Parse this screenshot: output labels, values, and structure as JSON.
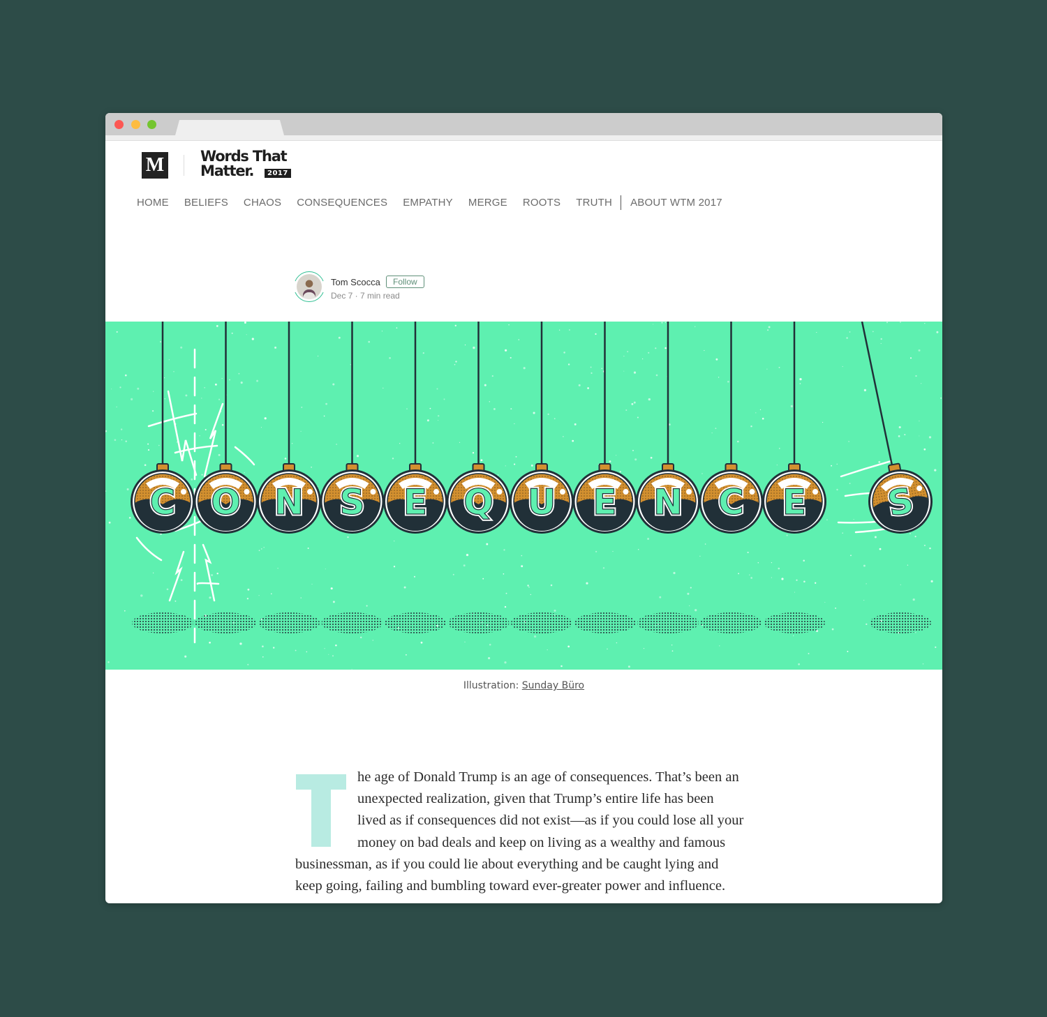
{
  "window": {
    "traffic_lights": [
      "close",
      "minimize",
      "zoom"
    ]
  },
  "header": {
    "medium_logo": "M",
    "publication_logo": {
      "line1": "Words That",
      "line2": "Matter.",
      "year": "2017"
    },
    "nav": [
      {
        "label": "HOME"
      },
      {
        "label": "BELIEFS"
      },
      {
        "label": "CHAOS"
      },
      {
        "label": "CONSEQUENCES"
      },
      {
        "label": "EMPATHY"
      },
      {
        "label": "MERGE"
      },
      {
        "label": "ROOTS"
      },
      {
        "label": "TRUTH"
      },
      {
        "label": "ABOUT WTM 2017"
      }
    ]
  },
  "byline": {
    "author": "Tom Scocca",
    "follow_label": "Follow",
    "meta": "Dec 7 · 7 min read"
  },
  "hero": {
    "title_letters": [
      "C",
      "O",
      "N",
      "S",
      "E",
      "Q",
      "U",
      "E",
      "N",
      "C",
      "E",
      "S"
    ],
    "colors": {
      "background": "#5ef0b0",
      "ornament_gold": "#d3902f",
      "ornament_dark": "#213038",
      "letter_mint": "#5ef0b0"
    }
  },
  "caption": {
    "prefix": "Illustration: ",
    "credit": "Sunday Büro"
  },
  "article": {
    "dropcap": "T",
    "lines": [
      "he age of Donald Trump is an age of consequences. That’s been an",
      "unexpected realization, given that Trump’s entire life has been",
      "lived as if consequences did not exist—as if you could lose all your",
      "money on bad deals and keep on living as a wealthy and famous",
      "businessman, as if you could lie about everything and be caught lying and",
      "keep going, failing and bumbling toward ever-greater power and influence."
    ]
  }
}
